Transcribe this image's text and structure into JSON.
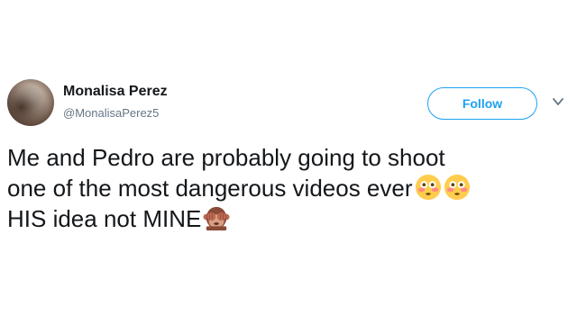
{
  "user": {
    "display_name": "Monalisa Perez",
    "handle": "@MonalisaPerez5"
  },
  "actions": {
    "follow_label": "Follow"
  },
  "tweet": {
    "line1": "Me and Pedro are probably going to shoot",
    "line2": "one of the most dangerous videos ever",
    "line3": "HIS idea not MINE"
  },
  "icons": {
    "flushed_face": "flushed-face-emoji",
    "see_no_evil_monkey": "see-no-evil-monkey-emoji",
    "chevron": "chevron-down-icon"
  },
  "colors": {
    "accent": "#1da1f2",
    "text": "#14171a",
    "secondary_text": "#657786"
  }
}
